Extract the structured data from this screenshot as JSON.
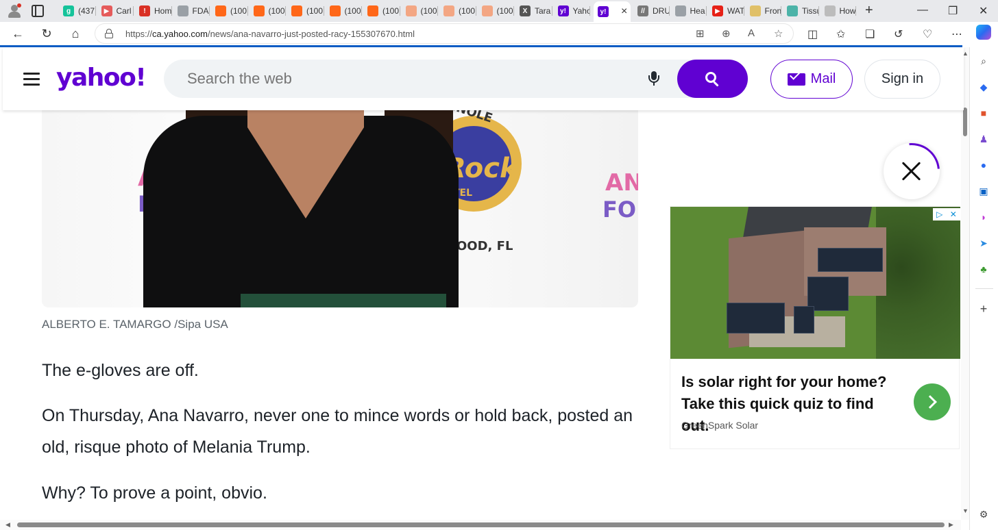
{
  "browser": {
    "tabs": [
      {
        "label": "(437",
        "icon": "grammarly-icon",
        "color": "#15c39a",
        "glyph": "g"
      },
      {
        "label": "Carl",
        "icon": "youtube-icon",
        "color": "#e55b5b",
        "glyph": "▶"
      },
      {
        "label": "Hom",
        "icon": "news-icon",
        "color": "#d93025",
        "glyph": "!"
      },
      {
        "label": "FDA",
        "icon": "page-icon",
        "color": "#9aa0a6",
        "glyph": ""
      },
      {
        "label": "(100",
        "icon": "substack-icon",
        "color": "#ff6719",
        "glyph": ""
      },
      {
        "label": "(100",
        "icon": "substack-icon",
        "color": "#ff6719",
        "glyph": ""
      },
      {
        "label": "(100",
        "icon": "substack-icon",
        "color": "#ff6719",
        "glyph": ""
      },
      {
        "label": "(100",
        "icon": "substack-icon",
        "color": "#ff6719",
        "glyph": ""
      },
      {
        "label": "(100",
        "icon": "substack-icon",
        "color": "#ff6719",
        "glyph": ""
      },
      {
        "label": "(100",
        "icon": "substack-icon",
        "color": "#f3a683",
        "glyph": ""
      },
      {
        "label": "(100",
        "icon": "substack-icon",
        "color": "#f3a683",
        "glyph": ""
      },
      {
        "label": "(100",
        "icon": "substack-icon",
        "color": "#f3a683",
        "glyph": ""
      },
      {
        "label": "Tara",
        "icon": "x-icon",
        "color": "#555555",
        "glyph": "X"
      },
      {
        "label": "Yaho",
        "icon": "yahoo-icon",
        "color": "#6001d2",
        "glyph": "y!"
      }
    ],
    "active_tab": {
      "icon": "yahoo-icon",
      "color": "#6001d2",
      "glyph": "y!",
      "close": "×"
    },
    "tabs_right": [
      {
        "label": "DRU",
        "icon": "drudge-icon",
        "color": "#777777",
        "glyph": "//"
      },
      {
        "label": "Hea",
        "icon": "page-icon",
        "color": "#9aa0a6",
        "glyph": ""
      },
      {
        "label": "WAT",
        "icon": "youtube-icon",
        "color": "#e62117",
        "glyph": "▶"
      },
      {
        "label": "Fron",
        "icon": "colorful-icon",
        "color": "#e0c068",
        "glyph": ""
      },
      {
        "label": "Tissu",
        "icon": "edge-icon",
        "color": "#4cb3a8",
        "glyph": ""
      },
      {
        "label": "How",
        "icon": "site-icon",
        "color": "#bcbcbc",
        "glyph": ""
      }
    ],
    "new_tab": "+",
    "window": {
      "minimize": "—",
      "restore": "❐",
      "close": "✕"
    },
    "url_prefix": "https://",
    "url_host": "ca.yahoo.com",
    "url_path": "/news/ana-navarro-just-posted-racy-155307670.html"
  },
  "yahoo": {
    "logo": "yahoo!",
    "search_placeholder": "Search the web",
    "mail_label": "Mail",
    "signin_label": "Sign in"
  },
  "article": {
    "photo_logo_left": "AM",
    "photo_logo_left2": "FO",
    "photo_logo_center": "Rock",
    "photo_logo_top": "MINOLE",
    "photo_logo_tel": "TEL",
    "photo_logo_bottom": "OOD, FL",
    "photo_logo_right": "AN",
    "photo_logo_right2": "FOR",
    "caption": "ALBERTO E. TAMARGO /Sipa USA",
    "paragraphs": [
      "The e-gloves are off.",
      "On Thursday, Ana Navarro, never one to mince words or hold back, posted an old, risque photo of Melania Trump.",
      "Why? To prove a point, obvio."
    ]
  },
  "ad": {
    "title": "Is solar right for your home? Take this quick quiz to find out.",
    "sponsor": "GreenSpark Solar",
    "adchoices": "▷",
    "adchoices_close": "✕"
  }
}
